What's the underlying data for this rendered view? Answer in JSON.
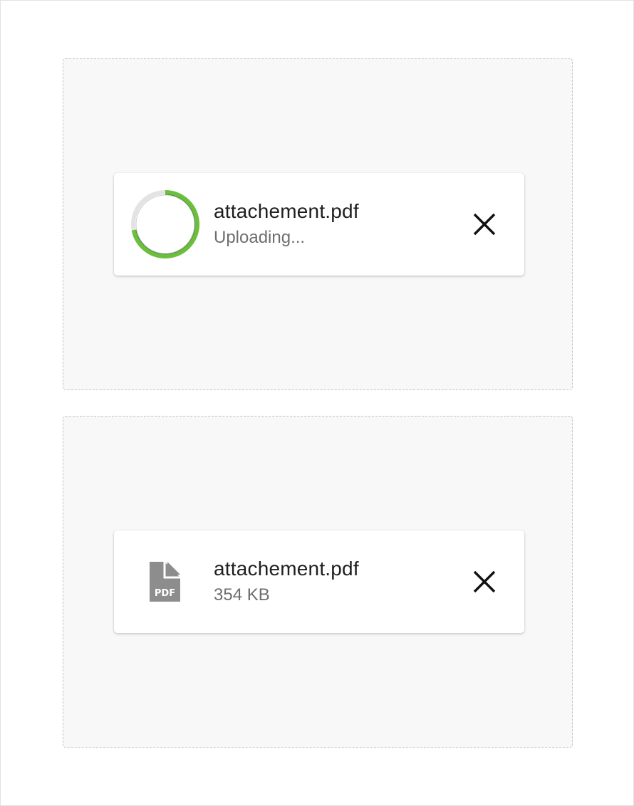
{
  "uploads": [
    {
      "file_name": "attachement.pdf",
      "status_text": "Uploading...",
      "progress_fraction": 0.72,
      "remove_icon": "close-icon"
    },
    {
      "file_name": "attachement.pdf",
      "size_text": "354 KB",
      "file_type_label": "PDF",
      "file_icon": "pdf-file-icon",
      "remove_icon": "close-icon"
    }
  ],
  "colors": {
    "progress_green": "#6bbf3a",
    "progress_dark_green": "#2e7d32",
    "progress_track": "#e3e3e3",
    "file_icon_gray": "#8d8d8d"
  }
}
